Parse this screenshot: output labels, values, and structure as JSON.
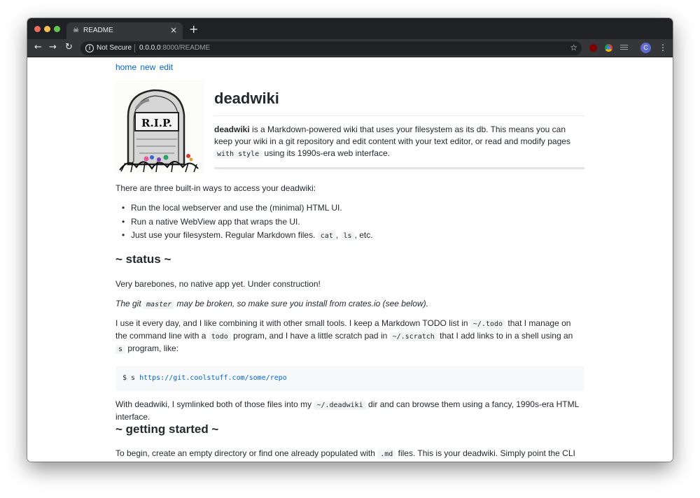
{
  "browser": {
    "tab_title": "README",
    "tab_close": "×",
    "new_tab": "+",
    "nav": {
      "back": "←",
      "forward": "→",
      "reload": "↻"
    },
    "security_label": "Not Secure",
    "url_host": "0.0.0.0",
    "url_rest": ":8000/README",
    "bookmark_icon": "☆",
    "avatar_initial": "C",
    "menu": "⋮",
    "extensions": [
      "ublock-icon",
      "chrome-icon",
      "reader-icon"
    ]
  },
  "nav_links": [
    "home",
    "new",
    "edit"
  ],
  "header": {
    "title": "deadwiki",
    "intro_bold": "deadwiki",
    "intro_1": " is a Markdown-powered wiki that uses your filesystem as its db. This means you can keep your wiki in a git repository and edit content with your text editor, or read and modify pages ",
    "intro_code": "with style",
    "intro_2": " using its 1990s-era web interface."
  },
  "access": {
    "lead": "There are three built-in ways to access your deadwiki:",
    "items": [
      "Run the local webserver and use the (minimal) HTML UI.",
      "Run a native WebView app that wraps the UI.",
      "Just use your filesystem. Regular Markdown files."
    ],
    "item3_code1": "cat",
    "item3_sep": ",",
    "item3_code2": "ls",
    "item3_tail": ", etc."
  },
  "status": {
    "heading": "~ status ~",
    "p1": "Very barebones, no native app yet. Under construction!",
    "p2_a": "The git ",
    "p2_code": "master",
    "p2_b": " may be broken, so make sure you install from crates.io (see below).",
    "p3_a": "I use it every day, and I like combining it with other small tools. I keep a Markdown TODO list in ",
    "p3_code1": "~/.todo",
    "p3_b": " that I manage on the command line with a ",
    "p3_code2": "todo",
    "p3_c": " program, and I have a little scratch pad in ",
    "p3_code3": "~/.scratch",
    "p3_d": " that I add links to in a shell using an ",
    "p3_code4": "s",
    "p3_e": " program, like:",
    "code_prompt": "$ s ",
    "code_url": "https://git.coolstuff.com/some/repo",
    "p4_a": "With deadwiki, I symlinked both of those files into my ",
    "p4_code": "~/.deadwiki",
    "p4_b": " dir and can browse them using a fancy, 1990s-era HTML interface."
  },
  "getting_started": {
    "heading": "~ getting started ~",
    "p1_a": "To begin, create an empty directory or find one already populated with ",
    "p1_code": ".md",
    "p1_b": " files. This is your deadwiki. Simply point the CLI utility at it to get going:"
  },
  "logo": {
    "text": "R.I.P."
  }
}
